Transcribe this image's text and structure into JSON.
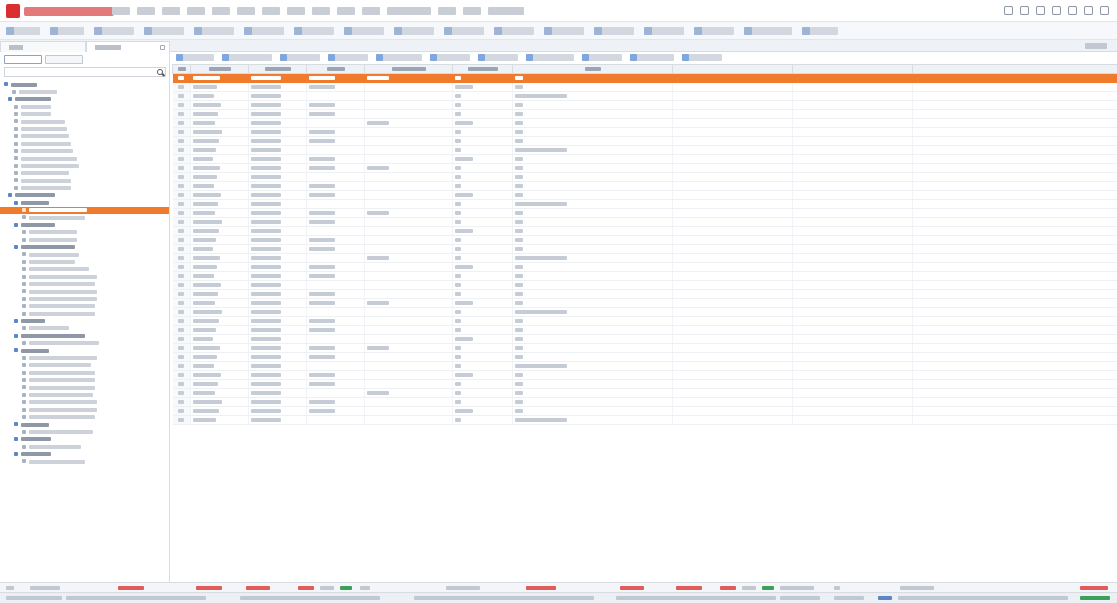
{
  "colors": {
    "accent": "#f07b2d",
    "brand": "#d92f2f",
    "rise": "#e25b5b",
    "fall": "#3aa05a",
    "link": "#5b85c7"
  },
  "icons": {
    "logo": "brand-logo-icon",
    "search": "search-icon",
    "close": "close-icon",
    "tree_node": "folder-icon",
    "tool": "toolbar-tool-icon"
  },
  "table": {
    "columns": 10,
    "visible_rows": 39,
    "selected_row": 1
  }
}
